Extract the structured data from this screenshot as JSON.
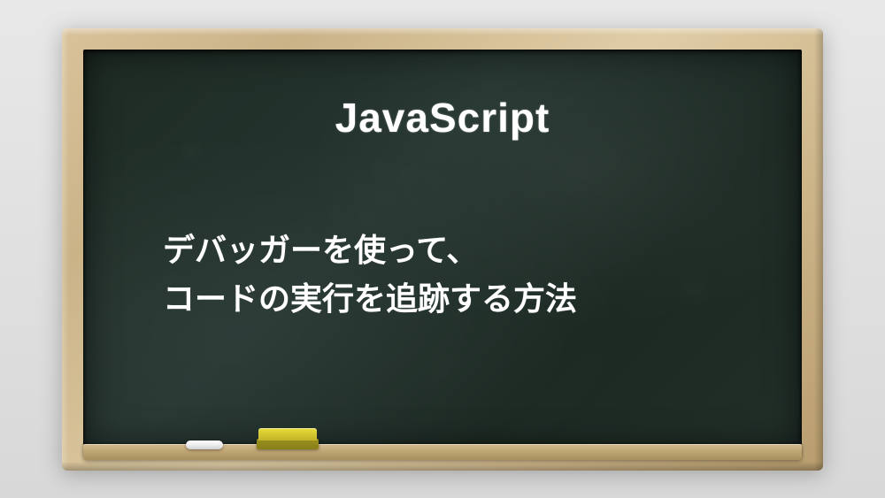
{
  "title": "JavaScript",
  "body_line1": "デバッガーを使って、",
  "body_line2": "コードの実行を追跡する方法"
}
